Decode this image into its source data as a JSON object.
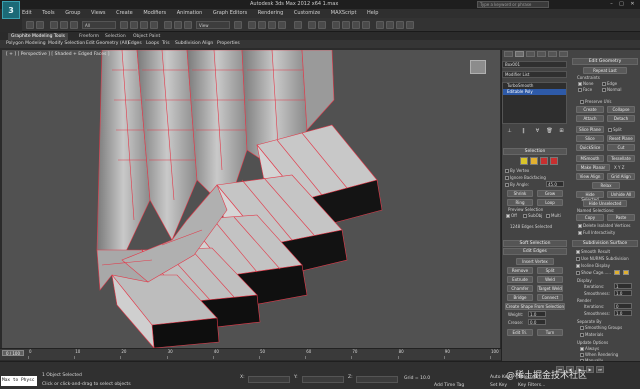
{
  "app": {
    "logo": "3",
    "title": "Autodesk 3ds Max 2012 x64   1.max",
    "search_placeholder": "Type a keyword or phrase"
  },
  "window_controls": [
    "–",
    "□",
    "✕"
  ],
  "menus": [
    "Edit",
    "Tools",
    "Group",
    "Views",
    "Create",
    "Modifiers",
    "Animation",
    "Graph Editors",
    "Rendering",
    "Customize",
    "MAXScript",
    "Help"
  ],
  "toolbar": {
    "selection_filter": "All",
    "view_select": "View"
  },
  "ribbon": {
    "tabs": [
      "Graphite Modeling Tools",
      "Freeform",
      "Selection",
      "Object Paint"
    ],
    "subtabs": [
      "Polygon Modeling",
      "Modify Selection",
      "Edit",
      "Geometry (All)",
      "Edges",
      "Loops",
      "Tris",
      "Subdivision",
      "Align",
      "Properties"
    ]
  },
  "viewport": {
    "label": "[ + ] [ Perspective ] [ Shaded + Edged Faces ]"
  },
  "modifier_stack": {
    "object_name": "Box001",
    "modifier_list": "Modifier List",
    "items": [
      "TurboSmooth",
      "Editable Poly"
    ],
    "selected_index": 1
  },
  "selection": {
    "title": "Selection",
    "by_vertex": "By Vertex",
    "ignore_backfacing": "Ignore Backfacing",
    "by_angle": "By Angle:",
    "by_angle_value": "45.0",
    "shrink": "Shrink",
    "grow": "Grow",
    "ring": "Ring",
    "loop": "Loop",
    "preview": "Preview Selection",
    "preview_options": [
      "Off",
      "SubObj",
      "Multi"
    ],
    "status": "1248 Edges Selected"
  },
  "soft_selection": {
    "title": "Soft Selection"
  },
  "edit_edges": {
    "title": "Edit Edges",
    "insert_vertex": "Insert Vertex",
    "remove": "Remove",
    "split": "Split",
    "extrude": "Extrude",
    "weld": "Weld",
    "chamfer": "Chamfer",
    "target_weld": "Target Weld",
    "bridge": "Bridge",
    "connect": "Connect",
    "create_shape": "Create Shape From Selection",
    "weight": "Weight:",
    "weight_value": "1.0",
    "crease": "Crease:",
    "crease_value": "0.0",
    "edit_tri": "Edit Tri.",
    "turn": "Turn"
  },
  "edit_geometry": {
    "title": "Edit Geometry",
    "repeat_last": "Repeat Last",
    "constraints": "Constraints",
    "constraint_options": [
      "None",
      "Edge",
      "Face",
      "Normal"
    ],
    "preserve_uvs": "Preserve UVs",
    "create": "Create",
    "collapse": "Collapse",
    "attach": "Attach",
    "detach": "Detach",
    "slice_plane": "Slice Plane",
    "split": "Split",
    "slice": "Slice",
    "reset_plane": "Reset Plane",
    "quickslice": "QuickSlice",
    "cut": "Cut",
    "msmooth": "MSmooth",
    "tessellate": "Tessellate",
    "make_planar": "Make Planar",
    "xyz": "X  Y  Z",
    "view_align": "View Align",
    "grid_align": "Grid Align",
    "relax": "Relax",
    "hide_selected": "Hide Selected",
    "unhide_all": "Unhide All",
    "hide_unselected": "Hide Unselected",
    "named_selections": "Named Selections:",
    "copy": "Copy",
    "paste": "Paste",
    "delete_isolated": "Delete Isolated Vertices",
    "full_interactivity": "Full Interactivity"
  },
  "subdivision_surface": {
    "title": "Subdivision Surface",
    "smooth_result": "Smooth Result",
    "use_nurms": "Use NURMS Subdivision",
    "isoline_display": "Isoline Display",
    "show_cage": "Show Cage......",
    "display": "Display",
    "iterations": "Iterations:",
    "iterations_value": "1",
    "smoothness": "Smoothness:",
    "smoothness_value": "1.0",
    "render": "Render",
    "render_iterations_value": "0",
    "render_smoothness_value": "1.0",
    "separate_by": "Separate By",
    "smoothing_groups": "Smoothing Groups",
    "materials": "Materials",
    "update_options": "Update Options",
    "always": "Always",
    "when_rendering": "When Rendering",
    "manually": "Manually"
  },
  "timeline": {
    "slider": "0 / 100",
    "ticks": [
      "0",
      "10",
      "20",
      "30",
      "40",
      "50",
      "60",
      "70",
      "80",
      "90",
      "100"
    ]
  },
  "status": {
    "maxscript": "Max to Physc",
    "selected": "1 Object Selected",
    "prompt": "Click or click-and-drag to select objects",
    "x": "X:",
    "y": "Y:",
    "z": "Z:",
    "grid": "Grid = 10.0",
    "add_time_tag": "Add Time Tag",
    "auto_key": "Auto Key",
    "selected_mode": "Selected",
    "set_key": "Set Key",
    "key_filters": "Key Filters...",
    "watermark": "@稀土掘金技术社区"
  },
  "colors": {
    "accent": "#2e5aa8",
    "wire": "#e23a4a",
    "mesh_light": "#c8c8c8",
    "mesh_dark": "#0f0f10",
    "viewport_bg": "#515151"
  }
}
